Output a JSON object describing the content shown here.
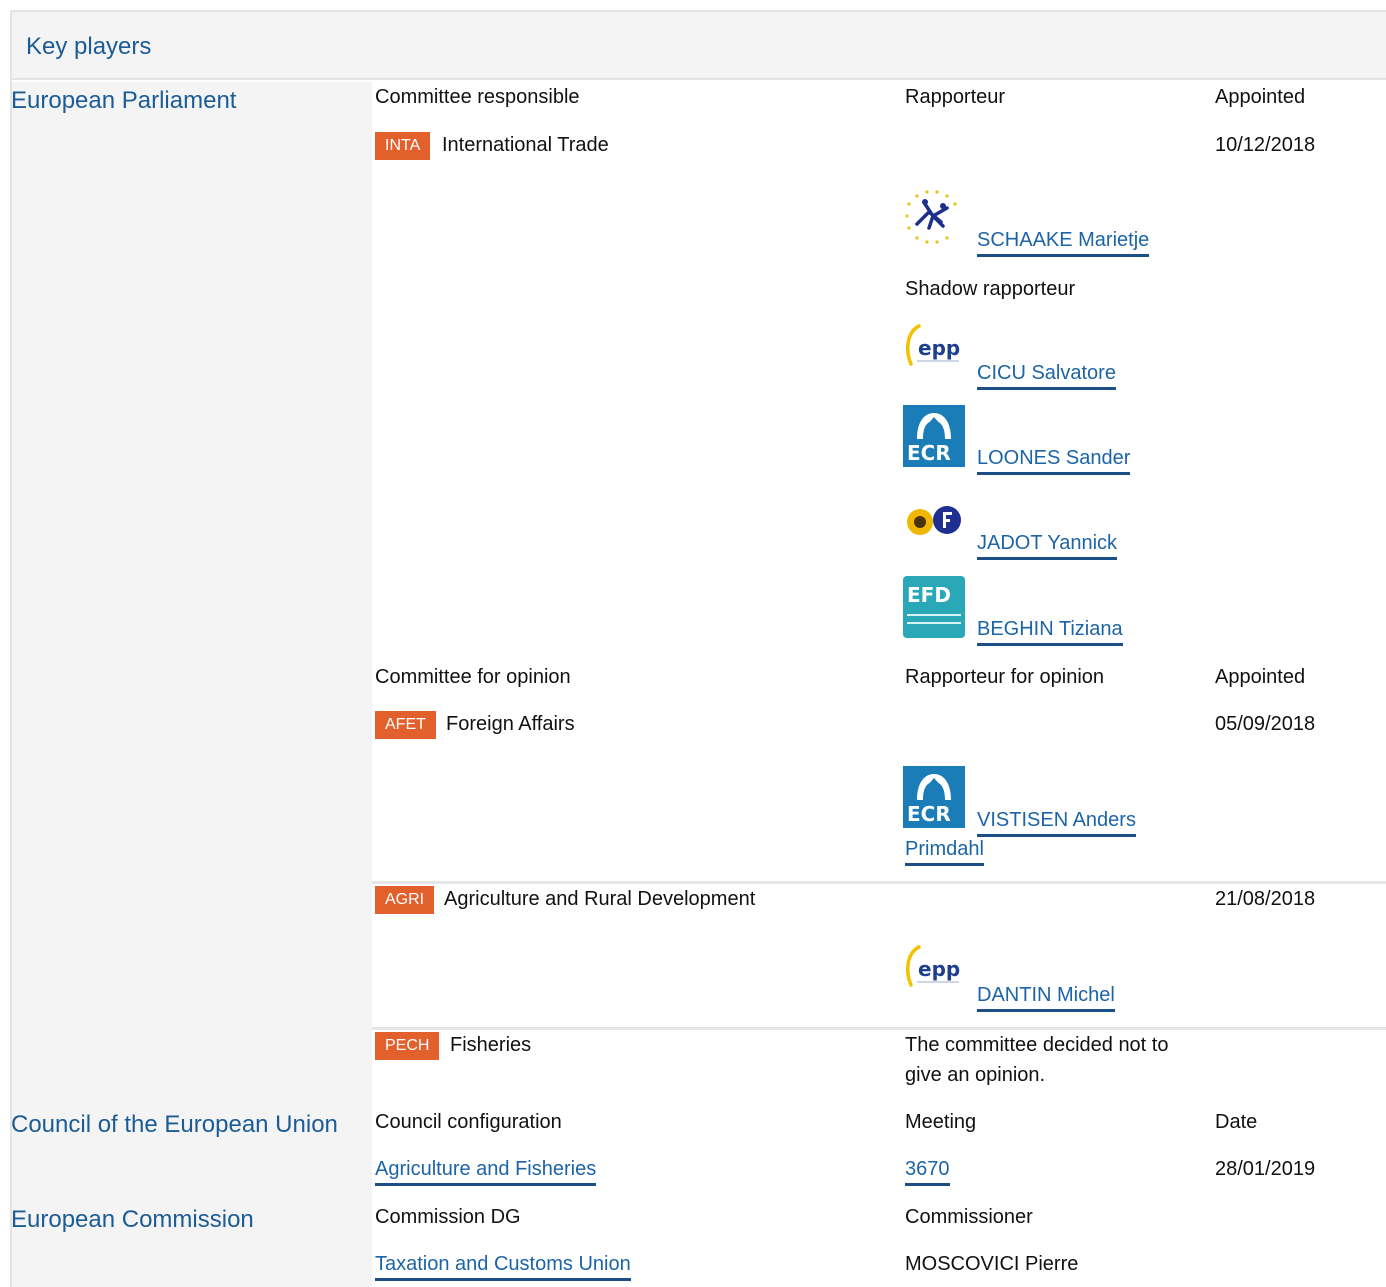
{
  "header": {
    "title": "Key players"
  },
  "parliament": {
    "label": "European Parliament",
    "responsible": {
      "headers": {
        "committee": "Committee responsible",
        "rapporteur": "Rapporteur",
        "appointed": "Appointed"
      },
      "committee": {
        "code": "INTA",
        "name": "International Trade",
        "date": "10/12/2018"
      },
      "rapporteur": {
        "name": "SCHAAKE Marietje",
        "group_logo": "alde-logo"
      },
      "shadow_label": "Shadow rapporteur",
      "shadows": [
        {
          "name": "CICU Salvatore",
          "group_logo": "epp-logo",
          "logo_text": "epp"
        },
        {
          "name": "LOONES Sander",
          "group_logo": "ecr-logo",
          "logo_text": "ECR"
        },
        {
          "name": "JADOT Yannick",
          "group_logo": "greens-efa-logo"
        },
        {
          "name": "BEGHIN Tiziana",
          "group_logo": "efdd-logo",
          "logo_text": "EFD"
        }
      ]
    },
    "opinion": {
      "headers": {
        "committee": "Committee for opinion",
        "rapporteur": "Rapporteur for opinion",
        "appointed": "Appointed"
      },
      "committees": [
        {
          "code": "AFET",
          "name": "Foreign Affairs",
          "date": "05/09/2018",
          "rapporteur": "VISTISEN Anders Primdahl",
          "rapporteur_line1": "VISTISEN Anders",
          "rapporteur_line2": "Primdahl",
          "group_logo": "ecr-logo",
          "logo_text": "ECR"
        },
        {
          "code": "AGRI",
          "name": "Agriculture and Rural Development",
          "date": "21/08/2018",
          "rapporteur": "DANTIN Michel",
          "group_logo": "epp-logo",
          "logo_text": "epp"
        },
        {
          "code": "PECH",
          "name": "Fisheries",
          "note_line1": "The committee decided not to",
          "note_line2": "give an opinion."
        }
      ]
    }
  },
  "council": {
    "label": "Council of the European Union",
    "headers": {
      "configuration": "Council configuration",
      "meeting": "Meeting",
      "date": "Date"
    },
    "row": {
      "configuration": "Agriculture and Fisheries",
      "meeting": "3670",
      "date": "28/01/2019"
    }
  },
  "commission": {
    "label": "European Commission",
    "headers": {
      "dg": "Commission DG",
      "commissioner": "Commissioner"
    },
    "row": {
      "dg": "Taxation and Customs Union",
      "commissioner": "MOSCOVICI Pierre"
    }
  },
  "colors": {
    "link": "#1c64a8",
    "badge": "#e2602c",
    "panel": "#f4f4f4",
    "ecr": "#1a7db8",
    "efdd": "#2aa8b8"
  }
}
